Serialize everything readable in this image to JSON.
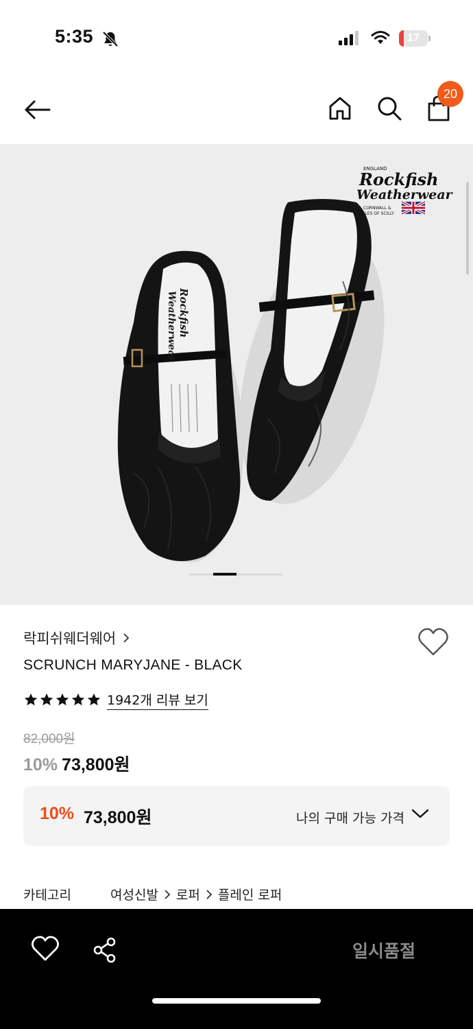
{
  "status_bar": {
    "time": "5:35",
    "battery_level": "17",
    "battery_color": "#e8453c"
  },
  "nav": {
    "back_icon": "arrow-left-icon",
    "home_icon": "home-icon",
    "search_icon": "search-icon",
    "bag_icon": "shopping-bag-icon",
    "cart_count": "20",
    "badge_color": "#f05a1a"
  },
  "hero": {
    "logo_line1": "ENGLAND",
    "logo_line2": "Rockfish",
    "logo_line3": "Weatherwear",
    "logo_line4": "CORNWALL &",
    "logo_line5": "ISLES OF SCILLY",
    "slide_index": 1
  },
  "product": {
    "brand": "락피쉬웨더웨어",
    "name": "SCRUNCH MARYJANE - BLACK",
    "rating_stars": 5,
    "review_link": "1942개 리뷰 보기",
    "original_price": "82,000원",
    "discount": "10%",
    "sale_price": "73,800원"
  },
  "my_price": {
    "discount": "10%",
    "price": "73,800원",
    "label": "나의 구매 가능 가격",
    "accent_color": "#f04d1a"
  },
  "category": {
    "label": "카테고리",
    "path": [
      "여성신발",
      "로퍼",
      "플레인 로퍼"
    ]
  },
  "bottom_bar": {
    "heart_icon": "heart-outline-icon",
    "share_icon": "share-icon",
    "soldout_label": "일시품절"
  }
}
